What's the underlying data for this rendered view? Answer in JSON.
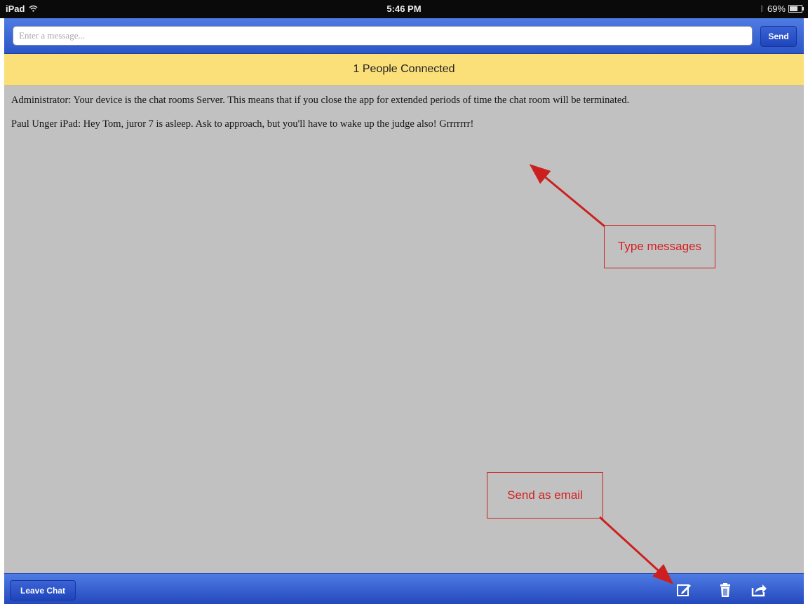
{
  "status_bar": {
    "device": "iPad",
    "time": "5:46 PM",
    "battery": "69%",
    "battery_level": 0.69
  },
  "message_input": {
    "placeholder": "Enter a message...",
    "value": ""
  },
  "send_button": {
    "label": "Send"
  },
  "banner": {
    "text": "1 People Connected"
  },
  "messages": [
    {
      "text": "Administrator: Your device is the chat rooms Server. This means that if you close the app for extended periods of time the chat room will be terminated."
    },
    {
      "text": "Paul Unger iPad: Hey Tom, juror 7 is asleep. Ask to approach, but you'll have to wake up the judge also!  Grrrrrrr!"
    }
  ],
  "bottom_toolbar": {
    "leave_label": "Leave Chat",
    "icons": [
      "compose-icon",
      "trash-icon",
      "share-icon"
    ]
  },
  "annotations": {
    "type_messages": "Type messages",
    "send_as_email": "Send as email",
    "color": "#cc2020"
  },
  "colors": {
    "toolbar_blue": "#3a65d8",
    "banner_yellow": "#fbe07a",
    "chat_background": "#c1c1c1"
  }
}
